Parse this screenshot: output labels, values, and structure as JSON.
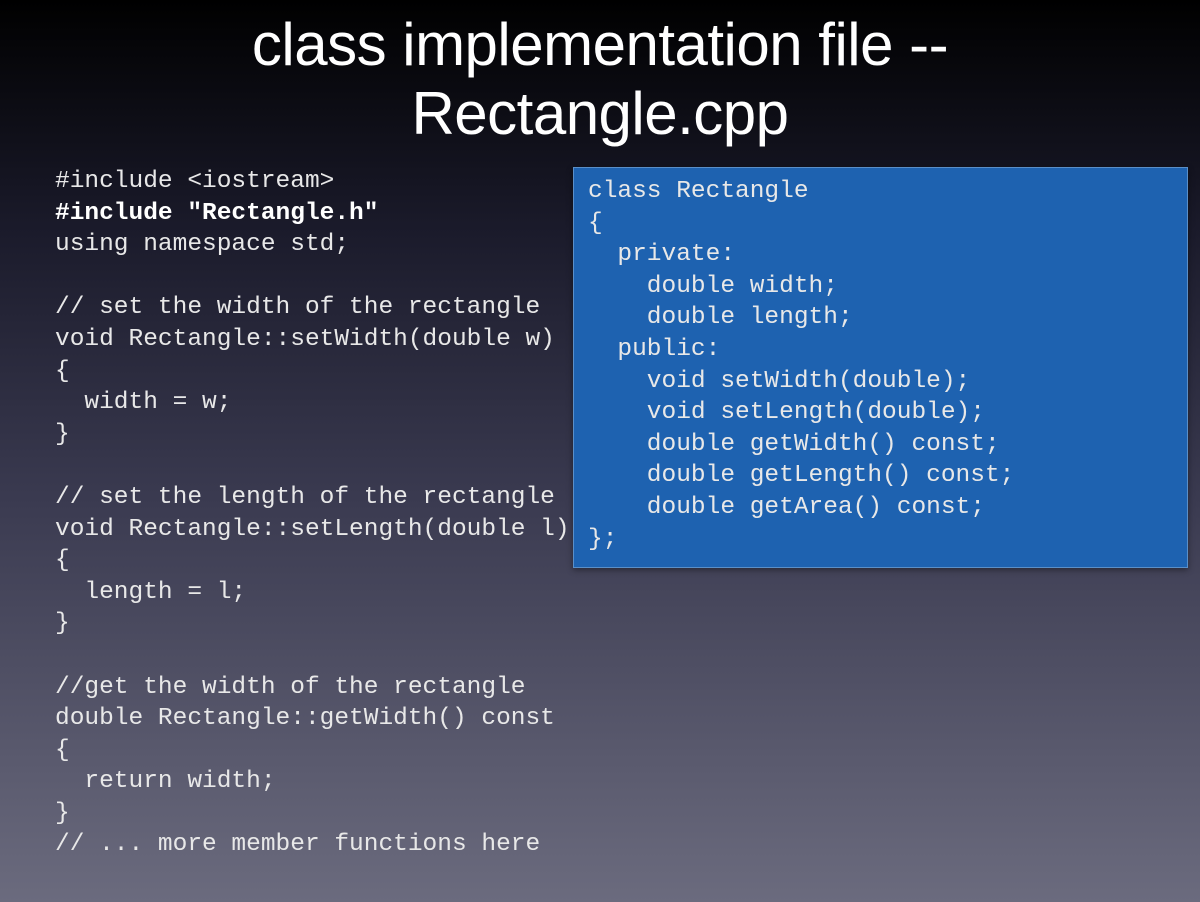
{
  "title": "class implementation file --\nRectangle.cpp",
  "main_code": {
    "line1": "#include <iostream>",
    "line2_bold": "#include \"Rectangle.h\"",
    "line3": "using namespace std;",
    "blank1": "",
    "line4": "// set the width of the rectangle",
    "line5": "void Rectangle::setWidth(double w)",
    "line6": "{",
    "line7": "  width = w;",
    "line8": "}",
    "blank2": "",
    "line9": "// set the length of the rectangle",
    "line10": "void Rectangle::setLength(double l)",
    "line11": "{",
    "line12": "  length = l;",
    "line13": "}",
    "blank3": "",
    "line14": "//get the width of the rectangle",
    "line15": "double Rectangle::getWidth() const",
    "line16": "{",
    "line17": "  return width;",
    "line18": "}",
    "line19": "// ... more member functions here"
  },
  "header_code": "class Rectangle\n{\n  private:\n    double width;\n    double length;\n  public:\n    void setWidth(double);\n    void setLength(double);\n    double getWidth() const;\n    double getLength() const;\n    double getArea() const;\n};"
}
